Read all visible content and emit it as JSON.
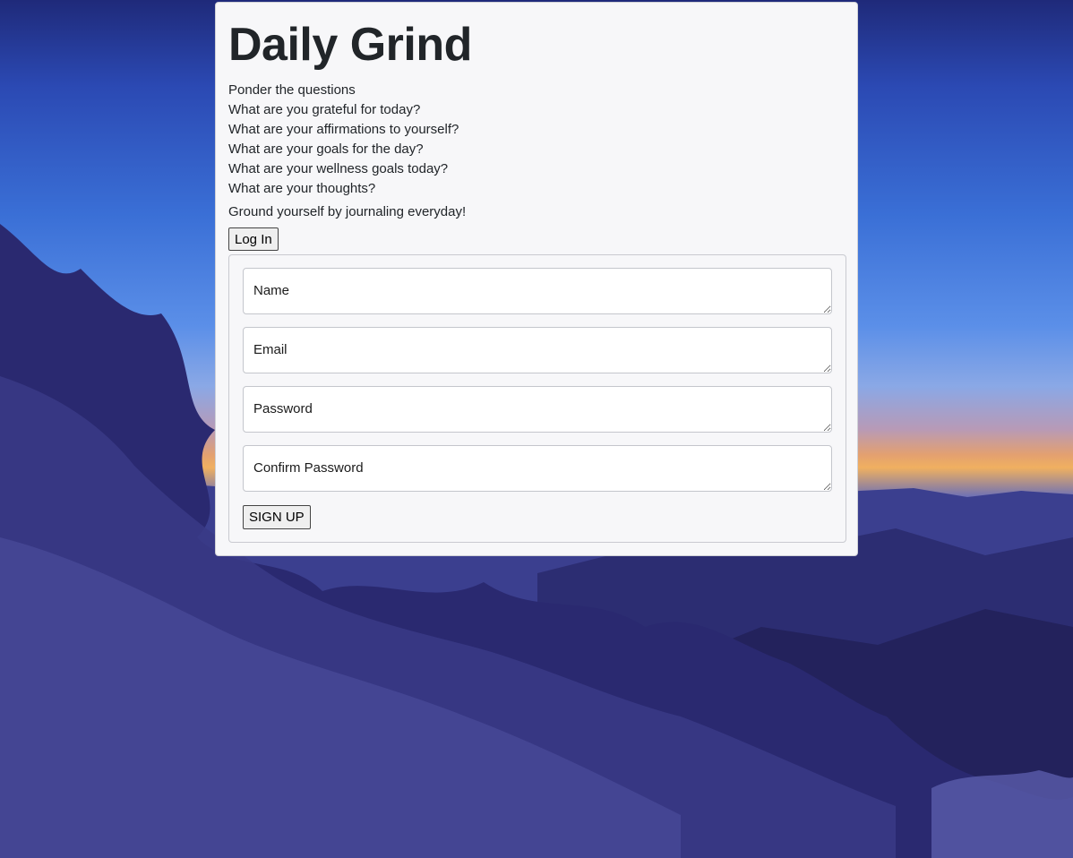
{
  "app": {
    "title": "Daily Grind",
    "subtitle": "Ponder the questions",
    "questions": [
      "What are you grateful for today?",
      "What are your affirmations to yourself?",
      "What are your goals for the day?",
      "What are your wellness goals today?",
      "What are your thoughts?"
    ],
    "tagline": "Ground yourself by journaling everyday!",
    "login_label": "Log In"
  },
  "signup": {
    "name_placeholder": "Name",
    "email_placeholder": "Email",
    "password_placeholder": "Password",
    "confirm_placeholder": "Confirm Password",
    "submit_label": "SIGN UP"
  },
  "colors": {
    "card_background": "#f7f7f9",
    "sky_top": "#1f2a7a",
    "sunset": "#f0b060"
  }
}
